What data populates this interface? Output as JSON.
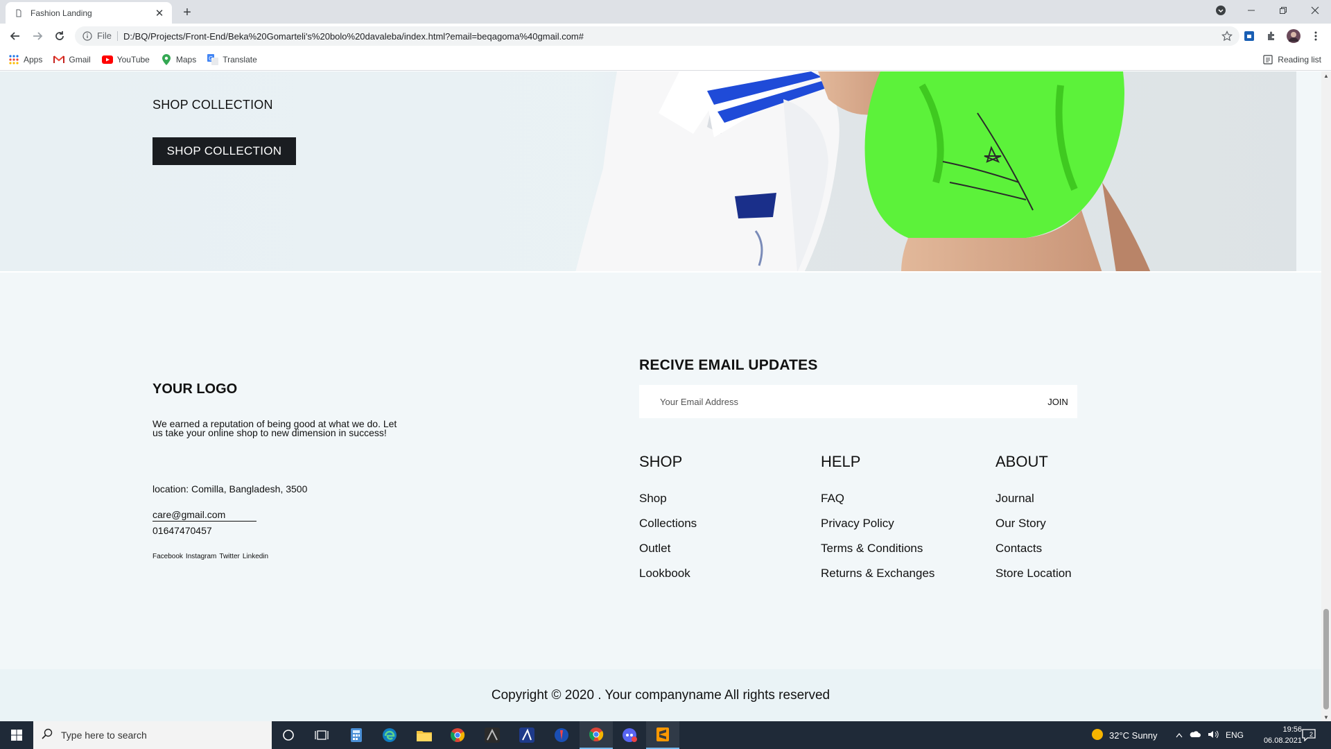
{
  "browser": {
    "tab_title": "Fashion Landing",
    "new_tab_label": "+",
    "file_label": "File",
    "url": "D:/BQ/Projects/Front-End/Beka%20Gomarteli's%20bolo%20davaleba/index.html?email=beqagoma%40gmail.com#",
    "bookmarks": [
      "Apps",
      "Gmail",
      "YouTube",
      "Maps",
      "Translate"
    ],
    "reading_list": "Reading list"
  },
  "hero": {
    "label": "SHOP COLLECTION",
    "button": "SHOP COLLECTION"
  },
  "footer": {
    "logo": "YOUR LOGO",
    "about": "We earned a reputation of being good at what we do. Let us take your online shop to new dimension in success!",
    "location": "location: Comilla, Bangladesh, 3500",
    "email": "care@gmail.com",
    "phone": "01647470457",
    "socials": [
      "Facebook",
      "Instagram",
      "Twitter",
      "Linkedin"
    ],
    "newsletter": {
      "title": "RECIVE EMAIL UPDATES",
      "placeholder": "Your Email Address",
      "button": "JOIN"
    },
    "columns": [
      {
        "title": "SHOP",
        "links": [
          "Shop",
          "Collections",
          "Outlet",
          "Lookbook"
        ]
      },
      {
        "title": "HELP",
        "links": [
          "FAQ",
          "Privacy Policy",
          "Terms & Conditions",
          "Returns & Exchanges"
        ]
      },
      {
        "title": "ABOUT",
        "links": [
          "Journal",
          "Our Story",
          "Contacts",
          "Store Location"
        ]
      }
    ],
    "copyright": "Copyright © 2020 . Your companyname All rights reserved"
  },
  "taskbar": {
    "search_placeholder": "Type here to search",
    "weather": "32°C  Sunny",
    "language": "ENG",
    "time": "19:56",
    "date": "06.08.2021",
    "notification_count": "2"
  },
  "colors": {
    "page_bg": "#f2f7f9",
    "button_dark": "#1a1d21",
    "taskbar": "#1f2a38",
    "neon_green": "#5cf23a"
  }
}
